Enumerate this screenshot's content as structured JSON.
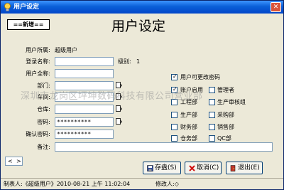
{
  "window": {
    "title": "用户设定",
    "close_icon": "close-icon"
  },
  "badge": "==新增==",
  "heading": "用户设定",
  "form": {
    "belong_label": "用户所属:",
    "belong_value": "超级用户",
    "login_label": "登录名称:",
    "login_value": "",
    "level_label": "级别:",
    "level_value": "1",
    "fullname_label": "用户全称:",
    "fullname_value": "",
    "dept_label": "部门:",
    "dept_value": "",
    "workshop_label": "车间:",
    "workshop_value": "",
    "warehouse_label": "仓库:",
    "warehouse_value": "",
    "password_label": "密码:",
    "password_value": "**********",
    "confirm_label": "确认密码:",
    "confirm_value": "**********",
    "remark_label": "备注:",
    "remark_value": ""
  },
  "permissions": [
    {
      "label": "用户可更改密码",
      "checked": true
    },
    {
      "label": "账户启用",
      "checked": true
    },
    {
      "label": "管理者",
      "checked": false
    },
    {
      "label": "工程部",
      "checked": false
    },
    {
      "label": "生产审核组",
      "checked": false
    },
    {
      "label": "生产部",
      "checked": false
    },
    {
      "label": "采购部",
      "checked": false
    },
    {
      "label": "财务部",
      "checked": false
    },
    {
      "label": "销售部",
      "checked": false
    },
    {
      "label": "仓务部",
      "checked": false
    },
    {
      "label": "QC部",
      "checked": false
    }
  ],
  "watermark": "深圳市龙岗区坪坤数码科技有限公司营业部",
  "nav": {
    "prev": "<",
    "next": ">"
  },
  "buttons": {
    "save": "存盘(S)",
    "cancel": "取消(C)",
    "exit": "退出(E)"
  },
  "status": {
    "creator": "制表人:《超级用户》2010-08-21 上午 11:02:04",
    "modifier": "修改人:◇"
  }
}
